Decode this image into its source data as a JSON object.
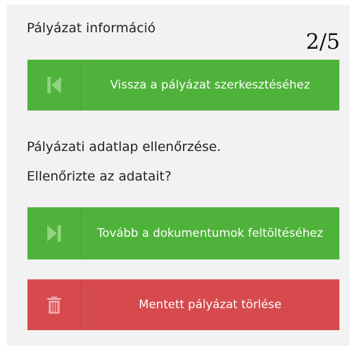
{
  "header": {
    "title": "Pályázat információ",
    "step": "2/5"
  },
  "buttons": {
    "back": {
      "label": "Vissza a pályázat szerkesztéséhez",
      "icon": "skip-back-icon",
      "color": "#4fb23a"
    },
    "next": {
      "label": "Tovább a dokumentumok feltöltéséhez",
      "icon": "skip-forward-icon",
      "color": "#4fb23a"
    },
    "delete": {
      "label": "Mentett pályázat törlése",
      "icon": "trash-icon",
      "color": "#d64a4d"
    }
  },
  "body": {
    "check_text": "Pályázati adatlap ellenőrzése.",
    "question": "Ellenőrizte az adatait?"
  }
}
